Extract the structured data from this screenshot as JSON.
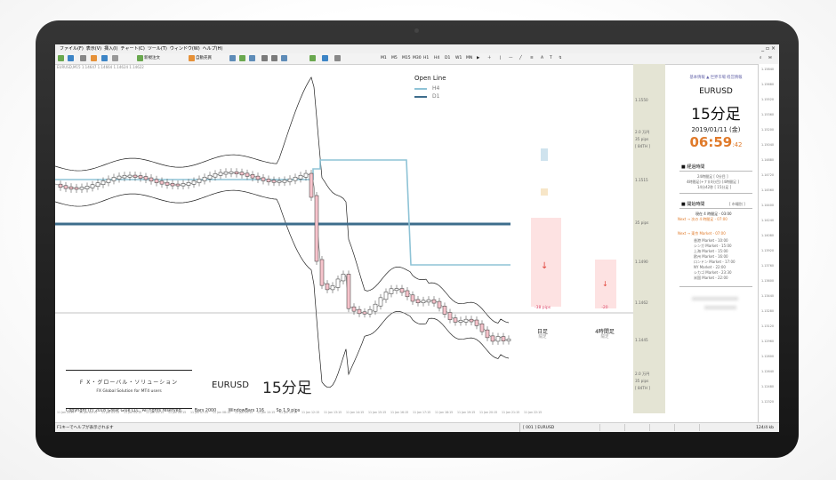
{
  "window": {
    "menu": [
      "ファイル(F)",
      "表示(V)",
      "挿入(I)",
      "チャート(C)",
      "ツール(T)",
      "ウィンドウ(W)",
      "ヘルプ(H)"
    ],
    "controls": "_ ▫ ×"
  },
  "toolbar": {
    "new_order": "新規注文",
    "auto_trade": "自動売買",
    "timeframes": [
      "M1",
      "M5",
      "M15",
      "M30",
      "H1",
      "H4",
      "D1",
      "W1",
      "MN"
    ]
  },
  "chart": {
    "header": "EURUSD,M15  1.14647 1.14664 1.14624 1.14622",
    "legend_title": "Open Line",
    "legend": [
      {
        "name": "H4",
        "color": "#8ec3d6"
      },
      {
        "name": "D1",
        "color": "#3e6d8c"
      }
    ],
    "colors": {
      "bull": "#ffffff",
      "bear": "#f4b9c2",
      "bear_body": "#f6c3cb",
      "open_h4": "#8ec3d6",
      "open_d1": "#3e6d8c",
      "bars": "#fde2e2",
      "arrow": "#e2453c"
    },
    "bars": [
      {
        "label": "日足",
        "sub": "陽足",
        "pips": "-38 pips"
      },
      {
        "label": "4時間足",
        "sub": "陽足",
        "pips": "-20"
      }
    ],
    "gray_col": {
      "price_top": "1.1550",
      "pct1": "2.0 万円",
      "pips1": "35 pips",
      "pair1": "[ 84TH ]",
      "price_mid": "1.1515",
      "pips_mid": "35 pips",
      "price_b": "1.1490",
      "price_c": "1.1462",
      "price_d": "1.1445",
      "pct2": "2.0 万円",
      "pips2": "35 pips",
      "pair2": "[ 84TH ]"
    },
    "brand_jp": "F X・グローバル・ソリューション",
    "brand_en": "FX Global Solution for MT4 users",
    "copyright": "Copyright (c) 2018  Great Glue LLC.  All rights reserved.",
    "bars_info": "Bars 2000",
    "window_bars": "WindowBars 116",
    "spread": "Sp  1.9 pips",
    "symbol": "EURUSD",
    "timeframe_label": "15分足",
    "time_ticks": [
      "11 Jan 2019",
      "11 Jan 02:15",
      "11 Jan 03:15",
      "11 Jan 04:15",
      "11 Jan 05:15",
      "11 Jan 06:15",
      "11 Jan 07:15",
      "11 Jan 08:15",
      "11 Jan 09:15",
      "11 Jan 10:15",
      "11 Jan 11:15",
      "11 Jan 12:15",
      "11 Jan 13:15",
      "11 Jan 14:15",
      "11 Jan 15:15",
      "11 Jan 16:15",
      "11 Jan 17:15",
      "11 Jan 18:15",
      "11 Jan 19:15",
      "11 Jan 20:15",
      "11 Jan 21:15",
      "11 Jan 22:15"
    ]
  },
  "panel": {
    "top_links": "基本情報 ▲ 世界市場 経営情報",
    "symbol": "EURUSD",
    "timeframe": "15分足",
    "date": "2019/01/11 (金)",
    "time": "06:59",
    "seconds": ":42",
    "section1": "■ 経過時間",
    "elapsed": [
      "24時間足  [ 0分目 ]",
      "4時間足(+ナ)(4分目)  [4時間足 ]",
      "14分42秒  [ 15分足 ]"
    ],
    "section2": "■ 開始時間",
    "section2_tag": "[ 市場別 ]",
    "start_rows": [
      "現在 4 時間足  - 03:00",
      "Next → 次の 4 時間足  - 07:00",
      "Next → 東京 Market  - 07:00"
    ],
    "markets": [
      "香港 Market  - 10:00",
      "シンガ Market  - 15:00",
      "上海 Market  - 15:00",
      "欧州 Market  - 16:00",
      "ロンドン Market - 17:00",
      "NY Market   - 22:00",
      "シカゴ Market  - 23:30",
      "米国 Market  - 22:00"
    ]
  },
  "price_axis": [
    "1.15840",
    "1.15680",
    "1.15520",
    "1.15360",
    "1.15200",
    "1.15040",
    "1.14880",
    "1.14720",
    "1.14560",
    "1.14400",
    "1.14240",
    "1.14080",
    "1.13920",
    "1.13760",
    "1.13600",
    "1.13440",
    "1.13280",
    "1.13120",
    "1.12960",
    "1.12800",
    "1.12640",
    "1.12480",
    "1.12320"
  ],
  "status": {
    "help": "F1キーでヘルプが表示されます",
    "profile": "[ 001 ]  EURUSD",
    "net": "124/4 kb"
  }
}
